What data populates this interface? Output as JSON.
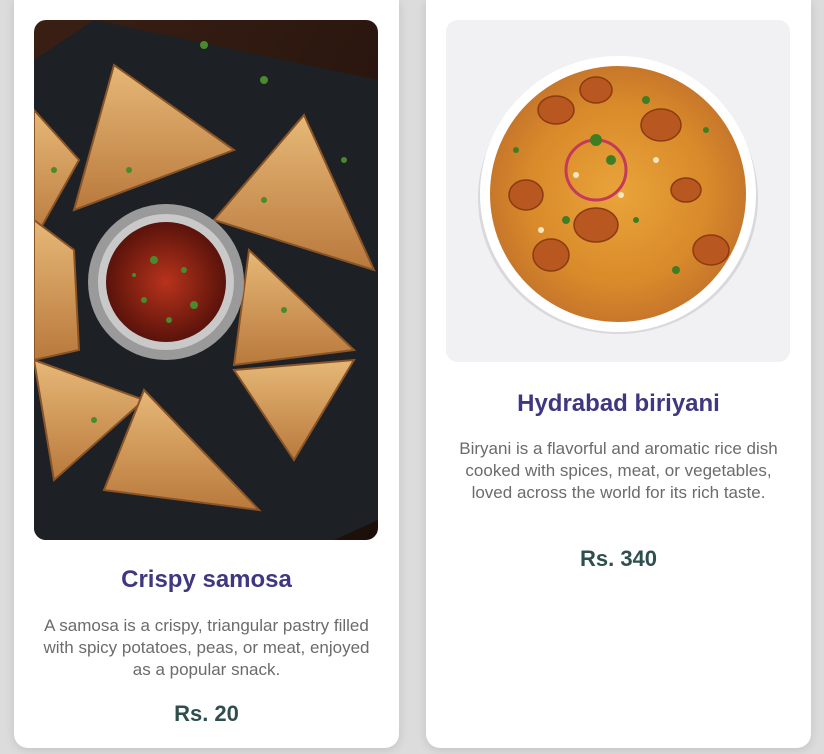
{
  "cards": [
    {
      "title": "Crispy samosa",
      "description": "A samosa is a crispy, triangular pastry filled with spicy potatoes, peas, or meat, enjoyed as a popular snack.",
      "price": "Rs. 20",
      "image_icon": "samosa-photo"
    },
    {
      "title": "Hydrabad biriyani",
      "description": "Biryani is a flavorful and aromatic rice dish cooked with spices, meat, or vegetables, loved across the world for its rich taste.",
      "price": "Rs. 340",
      "image_icon": "biryani-photo"
    }
  ],
  "colors": {
    "title": "#3f3780",
    "price": "#2f4f4f",
    "description": "#6b6b6b",
    "card": "#ffffff",
    "background": "#dcdcdc"
  }
}
